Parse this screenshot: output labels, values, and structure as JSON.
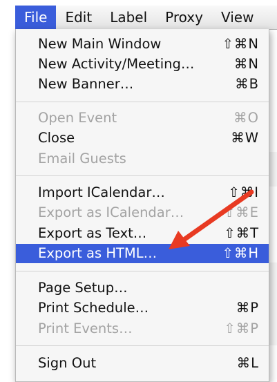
{
  "menubar": {
    "items": [
      {
        "label": "File",
        "active": true
      },
      {
        "label": "Edit",
        "active": false
      },
      {
        "label": "Label",
        "active": false
      },
      {
        "label": "Proxy",
        "active": false
      },
      {
        "label": "View",
        "active": false
      }
    ]
  },
  "file_menu": {
    "items": [
      {
        "label": "New Main Window",
        "shortcut": "⇧⌘N",
        "enabled": true,
        "selected": false
      },
      {
        "label": "New Activity/Meeting…",
        "shortcut": "⌘N",
        "enabled": true,
        "selected": false
      },
      {
        "label": "New Banner…",
        "shortcut": "⌘B",
        "enabled": true,
        "selected": false
      },
      {
        "label": "Open Event",
        "shortcut": "⌘O",
        "enabled": false,
        "selected": false
      },
      {
        "label": "Close",
        "shortcut": "⌘W",
        "enabled": true,
        "selected": false
      },
      {
        "label": "Email Guests",
        "shortcut": "",
        "enabled": false,
        "selected": false
      },
      {
        "label": "Import ICalendar…",
        "shortcut": "⇧⌘I",
        "enabled": true,
        "selected": false
      },
      {
        "label": "Export as ICalendar…",
        "shortcut": "⇧⌘E",
        "enabled": false,
        "selected": false
      },
      {
        "label": "Export as Text…",
        "shortcut": "⇧⌘T",
        "enabled": true,
        "selected": false
      },
      {
        "label": "Export as HTML…",
        "shortcut": "⇧⌘H",
        "enabled": true,
        "selected": true
      },
      {
        "label": "Page Setup…",
        "shortcut": "",
        "enabled": true,
        "selected": false
      },
      {
        "label": "Print Schedule…",
        "shortcut": "⌘P",
        "enabled": true,
        "selected": false
      },
      {
        "label": "Print Events…",
        "shortcut": "⇧⌘P",
        "enabled": false,
        "selected": false
      },
      {
        "label": "Sign Out",
        "shortcut": "⌘L",
        "enabled": true,
        "selected": false
      }
    ]
  },
  "annotation": {
    "type": "arrow",
    "color": "#e83a22",
    "points_to": "Export as HTML…"
  }
}
